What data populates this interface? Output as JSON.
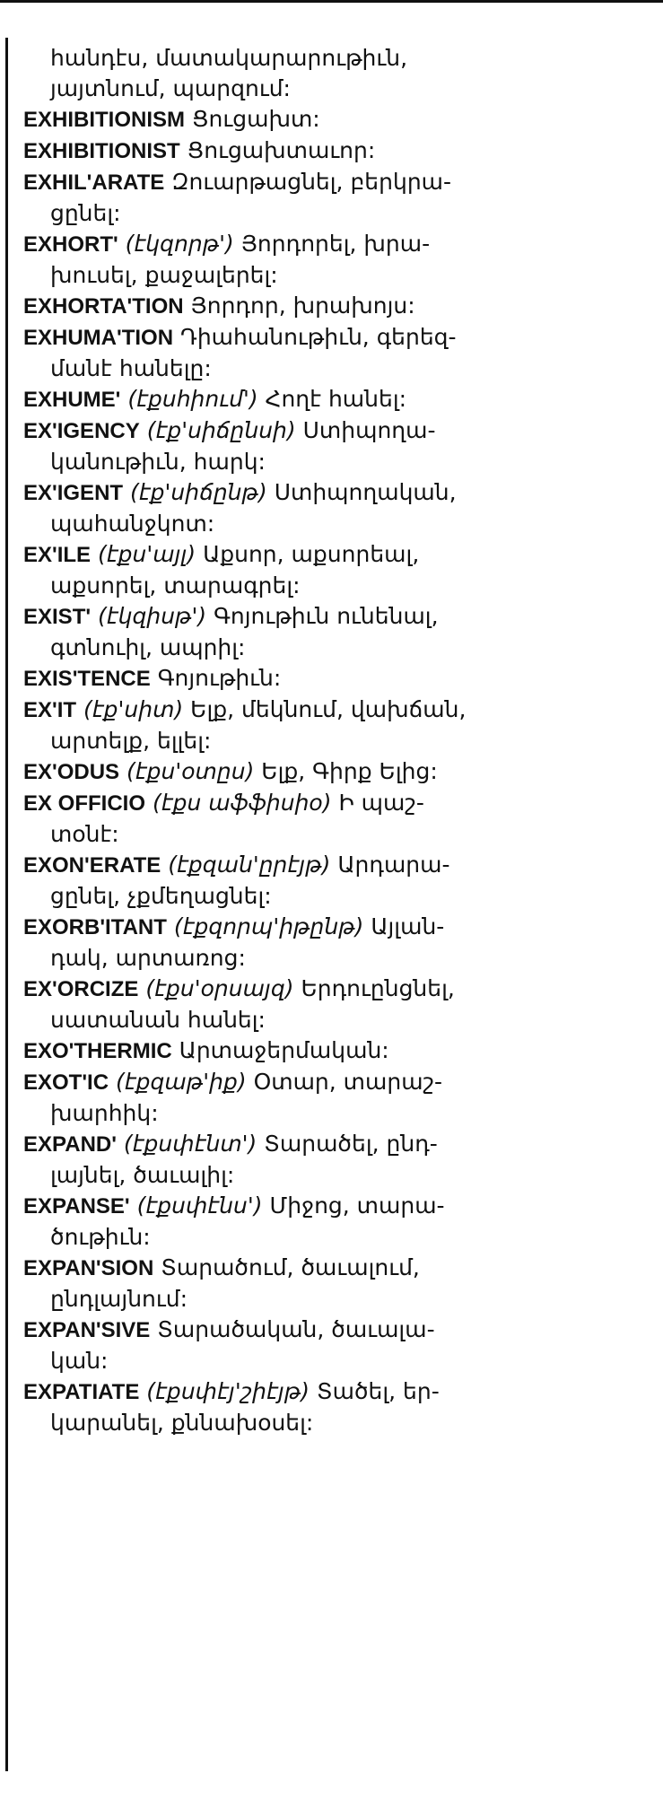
{
  "entries": [
    {
      "headword": "",
      "pron": "",
      "lines": [
        "",
        "հանդէս, մատակարարութիւն,",
        "յայտնում, պարզում:"
      ],
      "first_indent": true
    },
    {
      "headword": "EXHIBITIONISM",
      "pron": "",
      "lines": [
        "Ցուցախտ:"
      ]
    },
    {
      "headword": "EXHIBITIONIST",
      "pron": "",
      "lines": [
        "Ցուցախտաւոր:"
      ]
    },
    {
      "headword": "EXHIL'ARATE",
      "pron": "",
      "lines": [
        "Զուարթացնել, բերկրա-",
        "ցընել:"
      ]
    },
    {
      "headword": "EXHORT'",
      "pron": "(էկզորթ')",
      "lines": [
        "Յորդորել, խրա-",
        "խուսել, քաջալերել:"
      ]
    },
    {
      "headword": "EXHORTA'TION",
      "pron": "",
      "lines": [
        "Յորդոր, խրախոյս:"
      ]
    },
    {
      "headword": "EXHUMA'TION",
      "pron": "",
      "lines": [
        "Դիահանութիւն, գերեզ-",
        "մանէ հանելը:"
      ]
    },
    {
      "headword": "EXHUME'",
      "pron": "(էքսհիում')",
      "lines": [
        "Հողէ հանել:"
      ]
    },
    {
      "headword": "EX'IGENCY",
      "pron": "(էք'սիճընսի)",
      "lines": [
        "Ստիպողա-",
        "կանութիւն, հարկ:"
      ]
    },
    {
      "headword": "EX'IGENT",
      "pron": "(էք'սիճընթ)",
      "lines": [
        "Ստիպողական,",
        "պահանջկոտ:"
      ]
    },
    {
      "headword": "EX'ILE",
      "pron": "(էքս'այլ)",
      "lines": [
        "Աքսոր, աքսորեալ,",
        "աքսորել, տարագրել:"
      ]
    },
    {
      "headword": "EXIST'",
      "pron": "(էկզիսթ')",
      "lines": [
        "Գոյութիւն ունենալ,",
        "գտնուիլ, ապրիլ:"
      ]
    },
    {
      "headword": "EXIS'TENCE",
      "pron": "",
      "lines": [
        "Գոյութիւն:"
      ]
    },
    {
      "headword": "EX'IT",
      "pron": "(էք'սիտ)",
      "lines": [
        "Ելք, մեկնում, վախճան,",
        "արտելք, ելլել:"
      ]
    },
    {
      "headword": "EX'ODUS",
      "pron": "(էքս'օտըս)",
      "lines": [
        "Ելք, Գիրք Ելից:"
      ]
    },
    {
      "headword": "EX OFFICIO",
      "pron": "(էքս աֆֆիսիօ)",
      "lines": [
        "Ի պաշ-",
        "տօնէ:"
      ]
    },
    {
      "headword": "EXON'ERATE",
      "pron": "(էքզան'ըրէյթ)",
      "lines": [
        "Արդարա-",
        "ցընել, չքմեղացնել:"
      ]
    },
    {
      "headword": "EXORB'ITANT",
      "pron": "(էքզորպ'իթընթ)",
      "lines": [
        "Այլան-",
        "դակ, արտառոց:"
      ]
    },
    {
      "headword": "EX'ORCIZE",
      "pron": "(էքս'օրսայզ)",
      "lines": [
        "Երդուընցնել,",
        "սատանան հանել:"
      ]
    },
    {
      "headword": "EXO'THERMIC",
      "pron": "",
      "lines": [
        "Արտաջերմական:"
      ]
    },
    {
      "headword": "EXOT'IC",
      "pron": "(էքզաթ'իք)",
      "lines": [
        "Օտար, տարաշ-",
        "խարհիկ:"
      ]
    },
    {
      "headword": "EXPAND'",
      "pron": "(էքսփէնտ')",
      "lines": [
        "Տարածել, ընդ-",
        "լայնել, ծաւալիլ:"
      ]
    },
    {
      "headword": "EXPANSE'",
      "pron": "(էքսփէնս')",
      "lines": [
        "Միջոց, տարա-",
        "ծութիւն:"
      ]
    },
    {
      "headword": "EXPAN'SION",
      "pron": "",
      "lines": [
        "Տարածում, ծաւալում,",
        "ընդլայնում:"
      ]
    },
    {
      "headword": "EXPAN'SIVE",
      "pron": "",
      "lines": [
        "Տարածական, ծաւալա-",
        "կան:"
      ]
    },
    {
      "headword": "EXPATIATE",
      "pron": "(էքսփէյ'շիէյթ)",
      "lines": [
        "Տածել, եր-",
        "կարանել, քննախօսել:"
      ]
    }
  ]
}
